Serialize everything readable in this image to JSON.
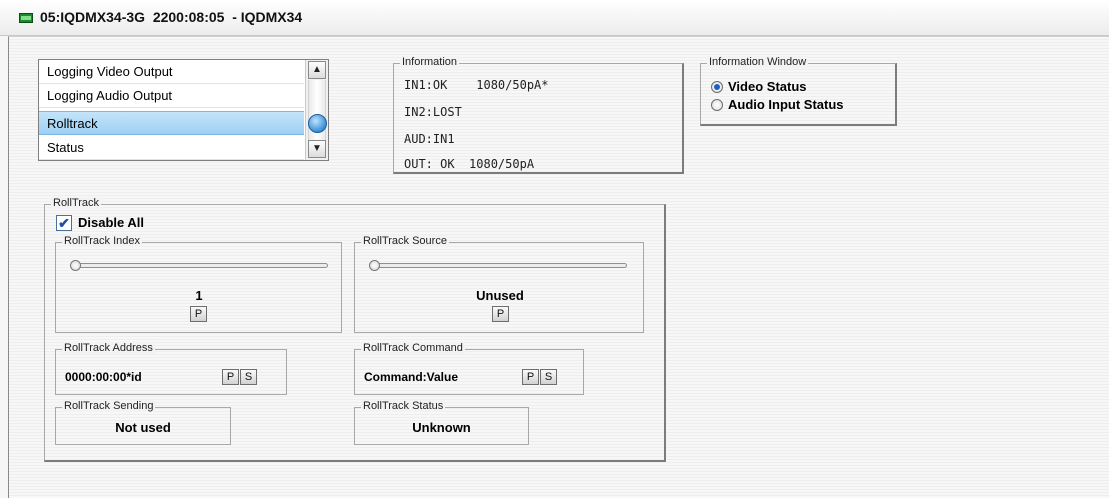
{
  "window": {
    "title": "05:IQDMX34-3G  2200:08:05  - IQDMX34"
  },
  "menu_list": {
    "items": [
      {
        "label": "Logging Video Output"
      },
      {
        "label": "Logging Audio Output"
      },
      {
        "label": "Rolltrack"
      },
      {
        "label": "Status"
      }
    ],
    "selected": "Rolltrack"
  },
  "information": {
    "legend": "Information",
    "lines": [
      "IN1:OK    1080/50pA*",
      "IN2:LOST",
      "AUD:IN1",
      "OUT: OK  1080/50pA"
    ]
  },
  "information_window": {
    "legend": "Information Window",
    "options": [
      {
        "label": "Video Status",
        "checked": true
      },
      {
        "label": "Audio Input Status",
        "checked": false
      }
    ]
  },
  "rolltrack": {
    "legend": "RollTrack",
    "disable_all_label": "Disable All",
    "disable_all_checked": true,
    "index": {
      "legend": "RollTrack Index",
      "value": "1",
      "button": "P",
      "slider_level": 0
    },
    "source": {
      "legend": "RollTrack Source",
      "value": "Unused",
      "button": "P",
      "slider_level": 0
    },
    "address": {
      "legend": "RollTrack Address",
      "value": "0000:00:00*id",
      "btn_p": "P",
      "btn_s": "S"
    },
    "command": {
      "legend": "RollTrack Command",
      "value": "Command:Value",
      "btn_p": "P",
      "btn_s": "S"
    },
    "sending": {
      "legend": "RollTrack Sending",
      "value": "Not used"
    },
    "status": {
      "legend": "RollTrack Status",
      "value": "Unknown"
    }
  },
  "colors": {
    "selection": "#9dd0f3",
    "radio_dot": "#1e5fc2",
    "panel_bg": "#f6f6f6"
  }
}
